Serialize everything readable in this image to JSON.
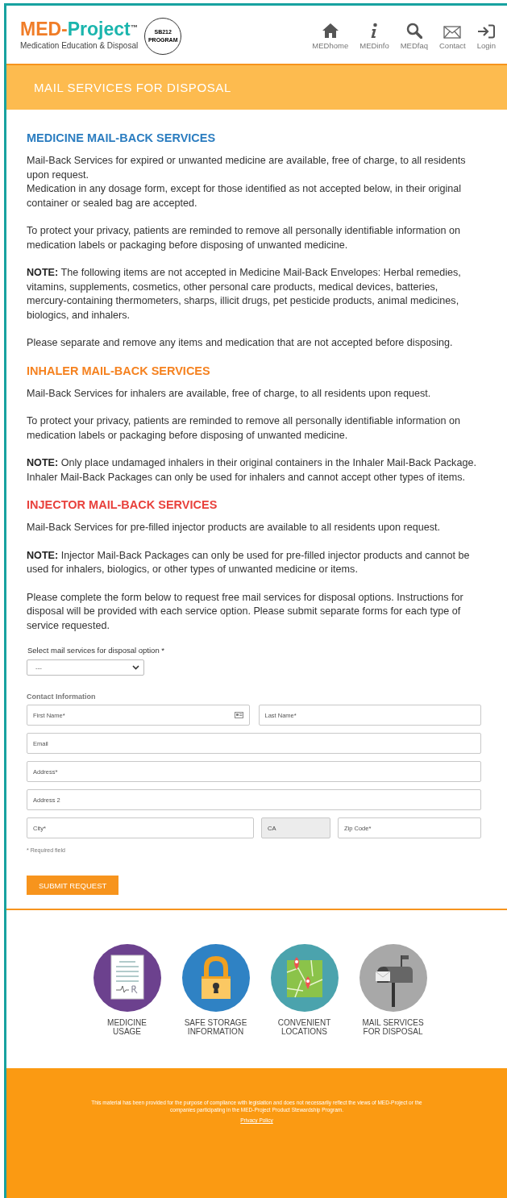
{
  "logo": {
    "brand_first": "MED-",
    "brand_second": "Project",
    "trademark": "™",
    "tagline": "Medication Education & Disposal",
    "badge_lines": [
      "SB212",
      "PROGRAM"
    ]
  },
  "nav": [
    {
      "label": "MEDhome",
      "kind": "home"
    },
    {
      "label": "MEDinfo",
      "kind": "info"
    },
    {
      "label": "MEDfaq",
      "kind": "search"
    },
    {
      "label": "Contact",
      "kind": "mail"
    },
    {
      "label": "Login",
      "kind": "login"
    }
  ],
  "banner": {
    "title": "MAIL SERVICES FOR DISPOSAL"
  },
  "sections": [
    {
      "title": "MEDICINE MAIL-BACK SERVICES",
      "color": "#2b7dc0",
      "paragraphs": [
        "Mail-Back Services for expired or unwanted medicine are available, free of charge, to all residents upon request.\nMedication in any dosage form, except for those identified as not accepted below, in their original container or sealed bag are accepted.",
        "To protect your privacy, patients are reminded to remove all personally identifiable information on medication labels or packaging before disposing of unwanted medicine.",
        "**NOTE:** The following items are not accepted in Medicine Mail-Back Envelopes: Herbal remedies, vitamins, supplements, cosmetics, other personal care products, medical devices, batteries, mercury-containing thermometers, sharps, illicit drugs, pet pesticide products, animal medicines, biologics, and inhalers.",
        "Please separate and remove any items and medication that are not accepted before disposing."
      ]
    },
    {
      "title": "INHALER MAIL-BACK SERVICES",
      "color": "#f58220",
      "paragraphs": [
        "Mail-Back Services for inhalers are available, free of charge, to all residents upon request.",
        "To protect your privacy, patients are reminded to remove all personally identifiable information on medication labels or packaging before disposing of unwanted medicine.",
        "**NOTE:** Only place undamaged inhalers in their original containers in the Inhaler Mail-Back Package. Inhaler Mail-Back Packages can only be used for inhalers and cannot accept other types of items."
      ]
    },
    {
      "title": "INJECTOR MAIL-BACK SERVICES",
      "color": "#e8413c",
      "paragraphs": [
        "Mail-Back Services for pre-filled injector products are available to all residents upon request.",
        "**NOTE:** Injector Mail-Back Packages can only be used for pre-filled injector products and cannot be used for inhalers, biologics, or other types of unwanted medicine or items."
      ]
    }
  ],
  "form": {
    "intro": "Please complete the form below to request free mail services for disposal options. Instructions for disposal will be provided with each service option. Please submit separate forms for each type of service requested.",
    "select_label": "Select mail services for disposal option *",
    "select_value": "---",
    "group_label": "Contact Information",
    "rows": [
      [
        {
          "placeholder": "First Name*",
          "contact_icon": true
        },
        {
          "placeholder": "Last Name*"
        }
      ],
      [
        {
          "placeholder": "Email"
        }
      ],
      [
        {
          "placeholder": "Address*"
        }
      ],
      [
        {
          "placeholder": "Address 2"
        }
      ],
      [
        {
          "placeholder": "City*"
        },
        {
          "value": "CA",
          "disabled": true
        },
        {
          "placeholder": "Zip Code*"
        }
      ]
    ],
    "required_note": "* Required field",
    "submit": "SUBMIT REQUEST"
  },
  "quick_links": [
    {
      "label": "MEDICINE\nUSAGE",
      "kind": "prescription",
      "color": "#6c418e"
    },
    {
      "label": "SAFE STORAGE\nINFORMATION",
      "kind": "lock",
      "color": "#2f82c4"
    },
    {
      "label": "CONVENIENT\nLOCATIONS",
      "kind": "map",
      "color": "#4ba3ad"
    },
    {
      "label": "MAIL SERVICES\nFOR DISPOSAL",
      "kind": "mailbox",
      "color": "#a8a8a8"
    }
  ],
  "footer": {
    "disclaimer": "This material has been provided for the purpose of compliance with legislation and does not necessarily reflect the views of MED-Project or the companies participating in the MED-Project Product Stewardship Program.",
    "link": "Privacy Policy"
  }
}
